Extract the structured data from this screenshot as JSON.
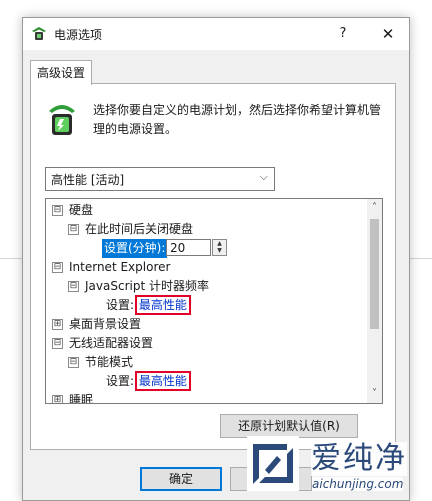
{
  "window": {
    "title": "电源选项",
    "help": "?",
    "close": "✕"
  },
  "tab": {
    "label": "高级设置"
  },
  "description": "选择你要自定义的电源计划，然后选择你希望计算机管理的电源设置。",
  "plan_combo": {
    "value": "高性能 [活动]",
    "arrow": "⌵"
  },
  "tree": {
    "hard_disk": {
      "label": "硬盘",
      "toggle": "⊟"
    },
    "turn_off_disk": {
      "label": "在此时间后关闭硬盘",
      "toggle": "⊟"
    },
    "disk_setting": {
      "label": "设置(分钟):",
      "value": "20"
    },
    "ie": {
      "label": "Internet Explorer",
      "toggle": "⊟"
    },
    "js_timer": {
      "label": "JavaScript 计时器频率",
      "toggle": "⊟"
    },
    "js_setting": {
      "label": "设置:",
      "value": "最高性能"
    },
    "desktop_bg": {
      "label": "桌面背景设置",
      "toggle": "⊞"
    },
    "wireless": {
      "label": "无线适配器设置",
      "toggle": "⊟"
    },
    "power_save": {
      "label": "节能模式",
      "toggle": "⊟"
    },
    "ps_setting": {
      "label": "设置:",
      "value": "最高性能"
    },
    "sleep": {
      "label": "睡眠",
      "toggle": "⊞"
    }
  },
  "scrollbar": {
    "up": "˄",
    "down": "˅"
  },
  "buttons": {
    "restore": "还原计划默认值(R)",
    "ok": "确定"
  },
  "watermark": {
    "title": "爱纯净",
    "url": "aichunjing.com"
  }
}
